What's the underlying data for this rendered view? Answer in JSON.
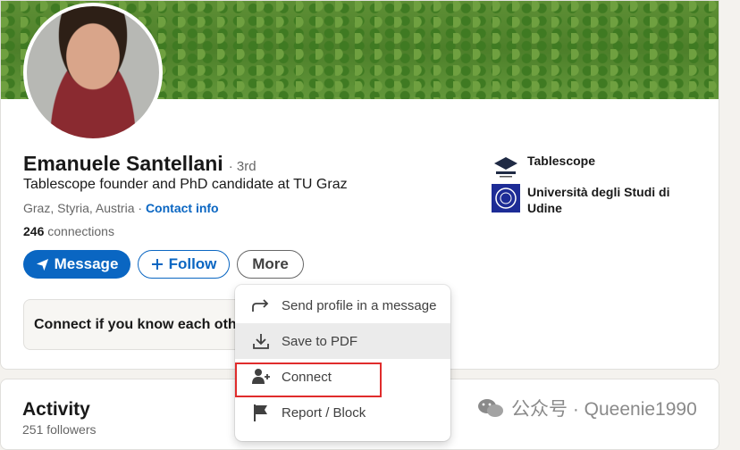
{
  "profile": {
    "name": "Emanuele Santellani",
    "degree": "· 3rd",
    "headline": "Tablescope founder and PhD candidate at TU Graz",
    "location": "Graz, Styria, Austria ·",
    "contact_info": "Contact info",
    "connections_count": "246",
    "connections_label": "connections"
  },
  "actions": {
    "message": "Message",
    "follow": "Follow",
    "more": "More"
  },
  "connect_prompt": "Connect if you know each other",
  "organizations": [
    {
      "name": "Tablescope",
      "icon": "tablescope-logo"
    },
    {
      "name": "Università degli Studi di Udine",
      "icon": "university-seal-logo"
    }
  ],
  "activity": {
    "title": "Activity",
    "followers": "251 followers"
  },
  "more_menu": {
    "items": [
      {
        "label": "Send profile in a message",
        "icon": "share-arrow-icon"
      },
      {
        "label": "Save to PDF",
        "icon": "download-icon"
      },
      {
        "label": "Connect",
        "icon": "add-person-icon"
      },
      {
        "label": "Report / Block",
        "icon": "flag-icon"
      }
    ]
  },
  "watermark": {
    "text": "公众号 · Queenie1990",
    "icon": "wechat-icon"
  },
  "colors": {
    "brand_blue": "#0a66c2",
    "highlight_red": "#e02c2c"
  }
}
